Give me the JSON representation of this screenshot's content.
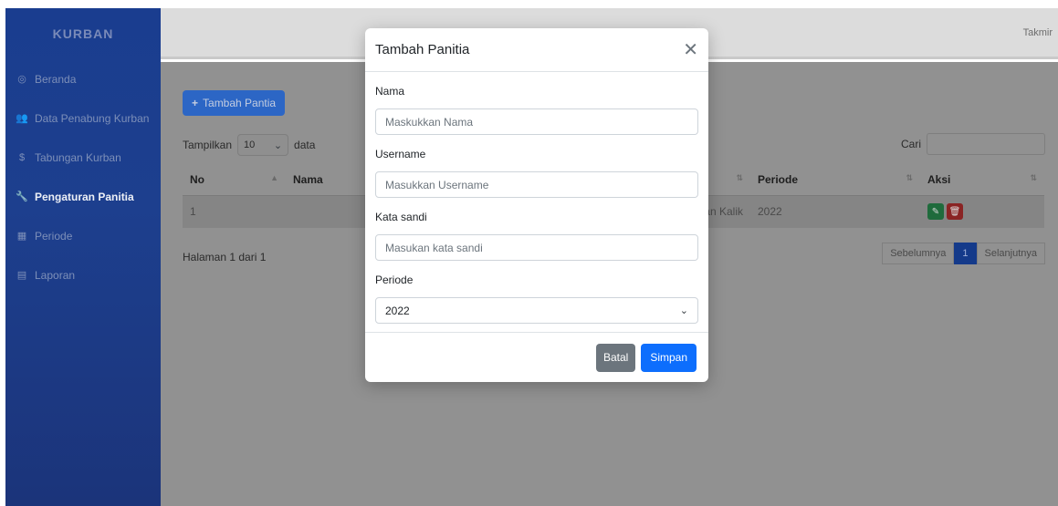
{
  "app": {
    "brand": "KURBAN",
    "user": "Takmir"
  },
  "sidebar": {
    "items": [
      {
        "label": "Beranda",
        "icon": "home-icon",
        "glyph": "◎"
      },
      {
        "label": "Data Penabung Kurban",
        "icon": "users-icon",
        "glyph": "👥"
      },
      {
        "label": "Tabungan Kurban",
        "icon": "dollar-icon",
        "glyph": "$"
      },
      {
        "label": "Pengaturan Panitia",
        "icon": "wrench-icon",
        "glyph": "🔧"
      },
      {
        "label": "Periode",
        "icon": "calendar-icon",
        "glyph": "▦"
      },
      {
        "label": "Laporan",
        "icon": "report-icon",
        "glyph": "▤"
      }
    ],
    "active_index": 3
  },
  "toolbar": {
    "add_label": "Tambah Pantia"
  },
  "table_controls": {
    "show_prefix": "Tampilkan",
    "show_value": "10",
    "show_suffix": "data",
    "search_label": "Cari"
  },
  "table": {
    "headers": [
      "No",
      "Nama",
      "Periode",
      "Aksi"
    ],
    "rows": [
      {
        "no": "1",
        "nama": "Lukman Kalik",
        "periode": "2022"
      }
    ]
  },
  "pagination": {
    "info": "Halaman 1 dari 1",
    "prev": "Sebelumnya",
    "current": "1",
    "next": "Selanjutnya"
  },
  "modal": {
    "title": "Tambah Panitia",
    "fields": [
      {
        "label": "Nama",
        "placeholder": "Maskukkan Nama"
      },
      {
        "label": "Username",
        "placeholder": "Masukkan Username"
      },
      {
        "label": "Kata sandi",
        "placeholder": "Masukan kata sandi"
      },
      {
        "label": "Periode",
        "value": "2022"
      }
    ],
    "cancel_label": "Batal",
    "save_label": "Simpan"
  },
  "colors": {
    "primary": "#0d6efd",
    "secondary": "#6c757d",
    "sidebar": "#1d3f8e",
    "success": "#198754",
    "danger": "#dc3545"
  }
}
